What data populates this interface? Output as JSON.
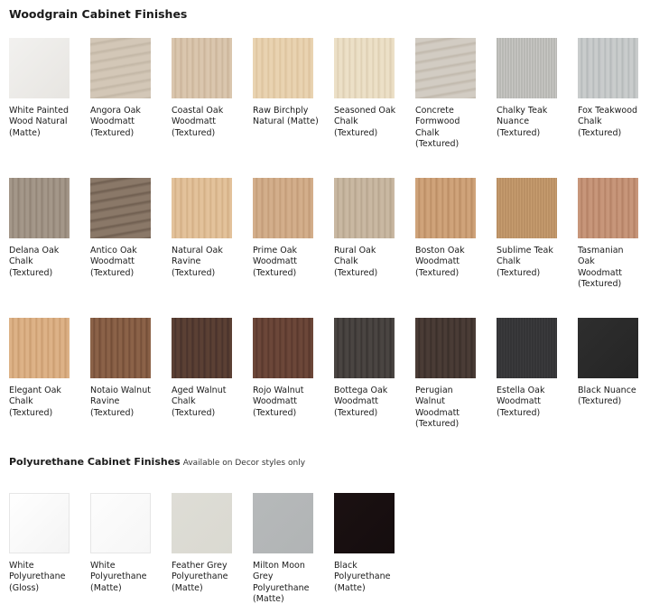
{
  "woodgrain": {
    "title": "Woodgrain Cabinet Finishes",
    "items": [
      {
        "name": "White Painted\nWood Natural\n(Matte)",
        "color": "#f2f1ef",
        "color2": "#e7e5e1",
        "pattern": "plain"
      },
      {
        "name": "Angora Oak\nWoodmatt\n(Textured)",
        "color": "#d3c7b7",
        "color2": "#c3b7a6",
        "pattern": "grain-h"
      },
      {
        "name": "Coastal Oak\nWoodmatt\n(Textured)",
        "color": "#dac6ae",
        "color2": "#c9b398",
        "pattern": "grain"
      },
      {
        "name": "Raw Birchply\nNatural (Matte)",
        "color": "#e9d3b1",
        "color2": "#dcc29c",
        "pattern": "grain"
      },
      {
        "name": "Seasoned Oak\nChalk\n(Textured)",
        "color": "#ece0c7",
        "color2": "#dccdb0",
        "pattern": "grain"
      },
      {
        "name": "Concrete\nFormwood\nChalk\n(Textured)",
        "color": "#d2ccc3",
        "color2": "#c1b9ad",
        "pattern": "grain-h"
      },
      {
        "name": "Chalky Teak\nNuance\n(Textured)",
        "color": "#c8c7c4",
        "color2": "#a9a8a5",
        "pattern": "grain-fine"
      },
      {
        "name": "Fox Teakwood\nChalk\n(Textured)",
        "color": "#c9cccc",
        "color2": "#b3b7b8",
        "pattern": "grain"
      },
      {
        "name": "Delana Oak\nChalk\n(Textured)",
        "color": "#a49789",
        "color2": "#8e8073",
        "pattern": "grain"
      },
      {
        "name": "Antico Oak\nWoodmatt\n(Textured)",
        "color": "#8a7868",
        "color2": "#6f5e50",
        "pattern": "grain-h"
      },
      {
        "name": "Natural Oak\nRavine\n(Textured)",
        "color": "#e3c29b",
        "color2": "#d2ad83",
        "pattern": "grain"
      },
      {
        "name": "Prime Oak\nWoodmatt\n(Textured)",
        "color": "#d3ae8b",
        "color2": "#c19a76",
        "pattern": "grain"
      },
      {
        "name": "Rural Oak\nChalk\n(Textured)",
        "color": "#c9b8a2",
        "color2": "#b5a38c",
        "pattern": "grain"
      },
      {
        "name": "Boston Oak\nWoodmatt\n(Textured)",
        "color": "#cfa37a",
        "color2": "#b98b62",
        "pattern": "grain"
      },
      {
        "name": "Sublime Teak\nChalk\n(Textured)",
        "color": "#c69c6f",
        "color2": "#ad8358",
        "pattern": "grain-fine"
      },
      {
        "name": "Tasmanian\nOak\nWoodmatt\n(Textured)",
        "color": "#c7967a",
        "color2": "#b27f63",
        "pattern": "grain"
      },
      {
        "name": "Elegant Oak\nChalk\n(Textured)",
        "color": "#ddb287",
        "color2": "#c99b6e",
        "pattern": "grain"
      },
      {
        "name": "Notaio Walnut\nRavine\n(Textured)",
        "color": "#8b6248",
        "color2": "#704b35",
        "pattern": "grain"
      },
      {
        "name": "Aged Walnut\nChalk\n(Textured)",
        "color": "#5b4034",
        "color2": "#46302a",
        "pattern": "grain"
      },
      {
        "name": "Rojo Walnut\nWoodmatt\n(Textured)",
        "color": "#6c4739",
        "color2": "#56362b",
        "pattern": "grain"
      },
      {
        "name": "Bottega Oak\nWoodmatt\n(Textured)",
        "color": "#4a4542",
        "color2": "#373230",
        "pattern": "grain"
      },
      {
        "name": "Perugian\nWalnut\nWoodmatt\n(Textured)",
        "color": "#4a3c36",
        "color2": "#382d28",
        "pattern": "grain"
      },
      {
        "name": "Estella Oak\nWoodmatt\n(Textured)",
        "color": "#3b3b3d",
        "color2": "#2d2d30",
        "pattern": "grain-fine"
      },
      {
        "name": "Black Nuance\n(Textured)",
        "color": "#2e2e2e",
        "color2": "#252525",
        "pattern": "plain"
      }
    ]
  },
  "polyurethane": {
    "title": "Polyurethane Cabinet Finishes",
    "subtitle": "Available on Decor styles only",
    "items": [
      {
        "name": "White\nPolyurethane\n(Gloss)",
        "color": "#ffffff",
        "color2": "#f4f4f4",
        "pattern": "plain",
        "border": true
      },
      {
        "name": "White\nPolyurethane\n(Matte)",
        "color": "#fdfdfd",
        "color2": "#f6f6f6",
        "pattern": "plain",
        "border": true
      },
      {
        "name": "Feather Grey\nPolyurethane\n(Matte)",
        "color": "#deddd6",
        "color2": "#dad9d1",
        "pattern": "plain"
      },
      {
        "name": "Milton Moon\nGrey\nPolyurethane\n(Matte)",
        "color": "#b6b9ba",
        "color2": "#b1b4b5",
        "pattern": "plain"
      },
      {
        "name": "Black\nPolyurethane\n(Matte)",
        "color": "#1b1112",
        "color2": "#150d0e",
        "pattern": "plain"
      }
    ]
  }
}
